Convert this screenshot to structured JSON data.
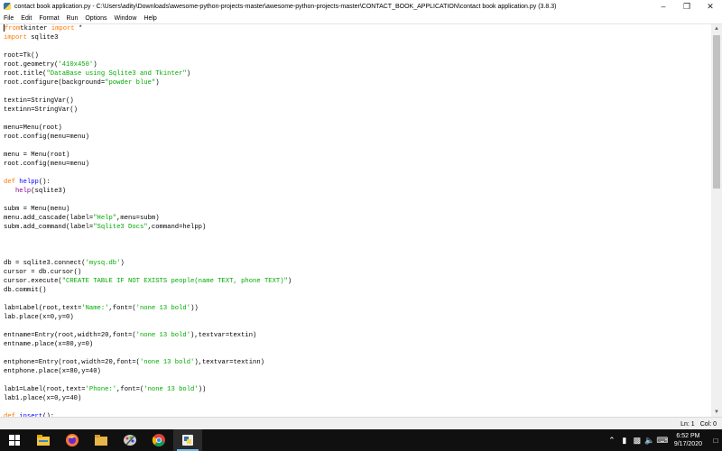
{
  "window": {
    "title": "contact book application.py - C:\\Users\\adity\\Downloads\\awesome-python-projects-master\\awesome-python-projects-master\\CONTACT_BOOK_APPLICATION\\contact book application.py (3.8.3)",
    "minimize": "–",
    "maximize": "❐",
    "close": "✕"
  },
  "menu": [
    "File",
    "Edit",
    "Format",
    "Run",
    "Options",
    "Window",
    "Help"
  ],
  "code_lines": [
    [
      [
        "kw",
        "from"
      ],
      [
        "",
        "tkinter "
      ],
      [
        "kw",
        "import"
      ],
      [
        "",
        " *"
      ]
    ],
    [
      [
        "kw",
        "import"
      ],
      [
        "",
        " sqlite3"
      ]
    ],
    [],
    [
      [
        "",
        "root=Tk()"
      ]
    ],
    [
      [
        "",
        "root.geometry("
      ],
      [
        "str",
        "'410x450'"
      ],
      [
        "",
        ")"
      ]
    ],
    [
      [
        "",
        "root.title("
      ],
      [
        "str",
        "\"DataBase using Sqlite3 and Tkinter\""
      ],
      [
        "",
        ")"
      ]
    ],
    [
      [
        "",
        "root.configure(background="
      ],
      [
        "str",
        "\"powder blue\""
      ],
      [
        "",
        ")"
      ]
    ],
    [],
    [
      [
        "",
        "textin=StringVar()"
      ]
    ],
    [
      [
        "",
        "textinn=StringVar()"
      ]
    ],
    [],
    [
      [
        "",
        "menu=Menu(root)"
      ]
    ],
    [
      [
        "",
        "root.config(menu=menu)"
      ]
    ],
    [],
    [
      [
        "",
        "menu = Menu(root)"
      ]
    ],
    [
      [
        "",
        "root.config(menu=menu)"
      ]
    ],
    [],
    [
      [
        "kw",
        "def"
      ],
      [
        "",
        " "
      ],
      [
        "fn",
        "helpp"
      ],
      [
        "",
        "():"
      ]
    ],
    [
      [
        "",
        "   "
      ],
      [
        "builtin",
        "help"
      ],
      [
        "",
        "(sqlite3)"
      ]
    ],
    [],
    [
      [
        "",
        "subm = Menu(menu)"
      ]
    ],
    [
      [
        "",
        "menu.add_cascade(label="
      ],
      [
        "str",
        "\"Help\""
      ],
      [
        "",
        ",menu=subm)"
      ]
    ],
    [
      [
        "",
        "subm.add_command(label="
      ],
      [
        "str",
        "\"Sqlite3 Docs\""
      ],
      [
        "",
        ",command=helpp)"
      ]
    ],
    [],
    [],
    [],
    [
      [
        "",
        "db = sqlite3.connect("
      ],
      [
        "str",
        "'mysq.db'"
      ],
      [
        "",
        ")"
      ]
    ],
    [
      [
        "",
        "cursor = db.cursor()"
      ]
    ],
    [
      [
        "",
        "cursor.execute("
      ],
      [
        "str",
        "\"CREATE TABLE IF NOT EXISTS people(name TEXT, phone TEXT)\""
      ],
      [
        "",
        ")"
      ]
    ],
    [
      [
        "",
        "db.commit()"
      ]
    ],
    [],
    [
      [
        "",
        "lab=Label(root,text="
      ],
      [
        "str",
        "'Name:'"
      ],
      [
        "",
        ",font=("
      ],
      [
        "str",
        "'none 13 bold'"
      ],
      [
        "",
        "))"
      ]
    ],
    [
      [
        "",
        "lab.place(x=0,y=0)"
      ]
    ],
    [],
    [
      [
        "",
        "entname=Entry(root,width=20,font=("
      ],
      [
        "str",
        "'none 13 bold'"
      ],
      [
        "",
        "),textvar=textin)"
      ]
    ],
    [
      [
        "",
        "entname.place(x=80,y=0)"
      ]
    ],
    [],
    [
      [
        "",
        "entphone=Entry(root,width=20,font=("
      ],
      [
        "str",
        "'none 13 bold'"
      ],
      [
        "",
        "),textvar=textinn)"
      ]
    ],
    [
      [
        "",
        "entphone.place(x=80,y=40)"
      ]
    ],
    [],
    [
      [
        "",
        "lab1=Label(root,text="
      ],
      [
        "str",
        "'Phone:'"
      ],
      [
        "",
        ",font=("
      ],
      [
        "str",
        "'none 13 bold'"
      ],
      [
        "",
        "))"
      ]
    ],
    [
      [
        "",
        "lab1.place(x=0,y=40)"
      ]
    ],
    [],
    [
      [
        "kw",
        "def"
      ],
      [
        "",
        " "
      ],
      [
        "fn",
        "insert"
      ],
      [
        "",
        "():"
      ]
    ]
  ],
  "status": {
    "line": "Ln: 1",
    "col": "Col: 0"
  },
  "taskbar": {
    "apps": [
      "file-explorer-icon",
      "firefox-icon",
      "folder-icon",
      "paint-icon",
      "chrome-icon",
      "python-idle-icon"
    ],
    "time": "6:52 PM",
    "date": "9/17/2020"
  }
}
